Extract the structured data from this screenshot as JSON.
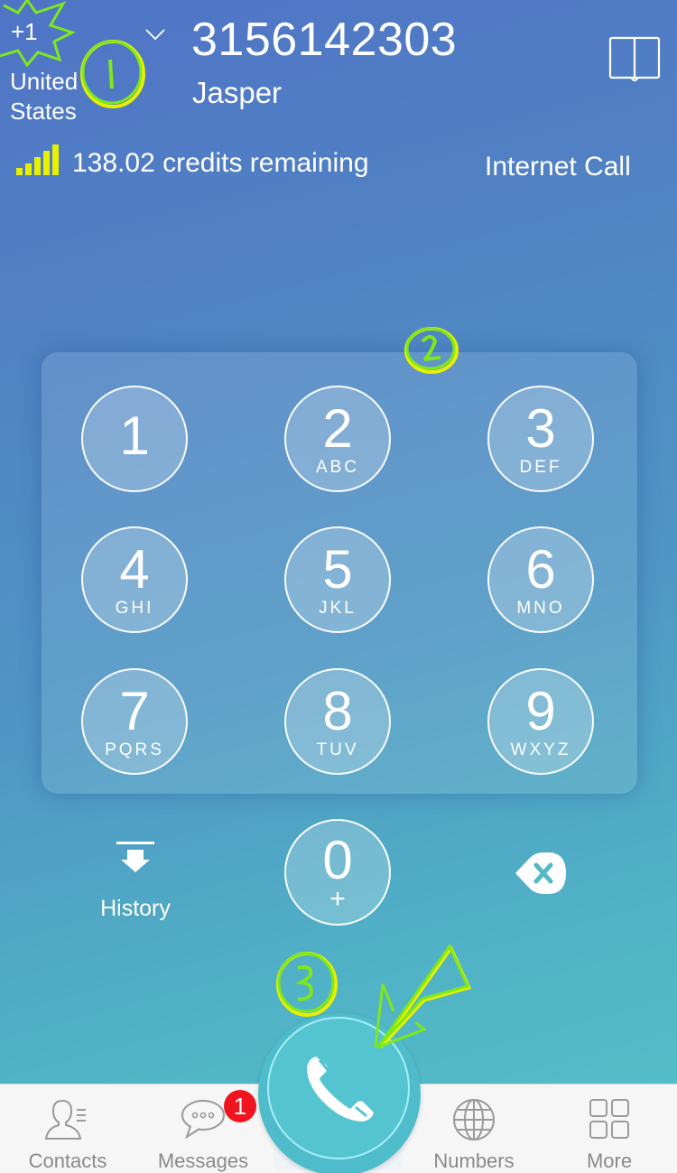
{
  "header": {
    "country_code": "+1",
    "country_name": "United States",
    "phone_number": "3156142303",
    "contact_name": "Jasper",
    "credits": "138.02 credits remaining",
    "call_mode": "Internet Call"
  },
  "keypad": {
    "keys": [
      {
        "digit": "1",
        "letters": ""
      },
      {
        "digit": "2",
        "letters": "ABC"
      },
      {
        "digit": "3",
        "letters": "DEF"
      },
      {
        "digit": "4",
        "letters": "GHI"
      },
      {
        "digit": "5",
        "letters": "JKL"
      },
      {
        "digit": "6",
        "letters": "MNO"
      },
      {
        "digit": "7",
        "letters": "PQRS"
      },
      {
        "digit": "8",
        "letters": "TUV"
      },
      {
        "digit": "9",
        "letters": "WXYZ"
      }
    ],
    "zero": {
      "digit": "0",
      "letters": "+"
    },
    "history_label": "History"
  },
  "tabbar": {
    "tabs": [
      {
        "label": "Contacts",
        "icon": "contacts-icon"
      },
      {
        "label": "Messages",
        "icon": "messages-icon",
        "badge": "1"
      },
      {
        "label": "",
        "icon": "phone-icon"
      },
      {
        "label": "Numbers",
        "icon": "globe-icon"
      },
      {
        "label": "More",
        "icon": "grid-icon"
      }
    ]
  },
  "annotations": [
    "1",
    "2",
    "3"
  ],
  "colors": {
    "accent_yellow": "#e8f000",
    "annotation_green": "#7ee81c",
    "badge_red": "#f0141e",
    "call_button": "#4fbccb",
    "tab_gray": "#8e8e8e"
  }
}
